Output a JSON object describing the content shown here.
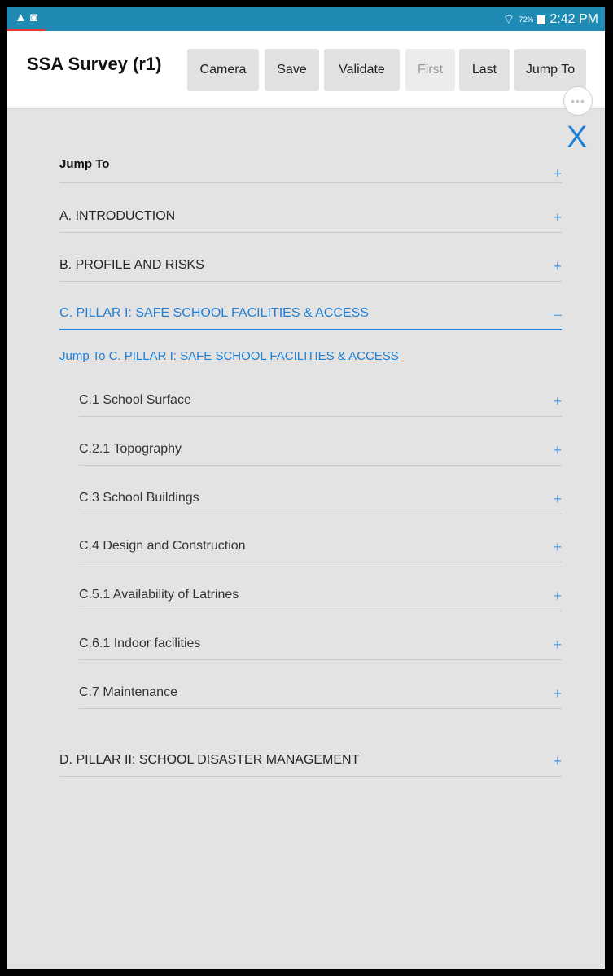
{
  "status_bar": {
    "battery": "72%",
    "time": "2:42 PM"
  },
  "header": {
    "title": "SSA Survey (r1)",
    "buttons": [
      "Camera",
      "Save",
      "Validate",
      "First",
      "Last",
      "Jump To"
    ]
  },
  "panel": {
    "close_label": "X",
    "heading": "Jump To",
    "sections": [
      {
        "label": "A. INTRODUCTION",
        "sign": "+"
      },
      {
        "label": "B. PROFILE AND RISKS",
        "sign": "+"
      },
      {
        "label": "C. PILLAR I: SAFE SCHOOL FACILITIES & ACCESS",
        "sign": "–"
      },
      {
        "label": "D. PILLAR II: SCHOOL DISASTER MANAGEMENT",
        "sign": "+"
      }
    ],
    "jump_link": "Jump To C. PILLAR I: SAFE SCHOOL FACILITIES & ACCESS",
    "subsections": [
      {
        "label": "C.1 School Surface",
        "sign": "+"
      },
      {
        "label": "C.2.1 Topography",
        "sign": "+"
      },
      {
        "label": "C.3 School Buildings",
        "sign": "+"
      },
      {
        "label": "C.4 Design and Construction",
        "sign": "+"
      },
      {
        "label": "C.5.1 Availability of Latrines",
        "sign": "+"
      },
      {
        "label": "C.6.1 Indoor facilities",
        "sign": "+"
      },
      {
        "label": "C.7 Maintenance",
        "sign": "+"
      }
    ]
  }
}
